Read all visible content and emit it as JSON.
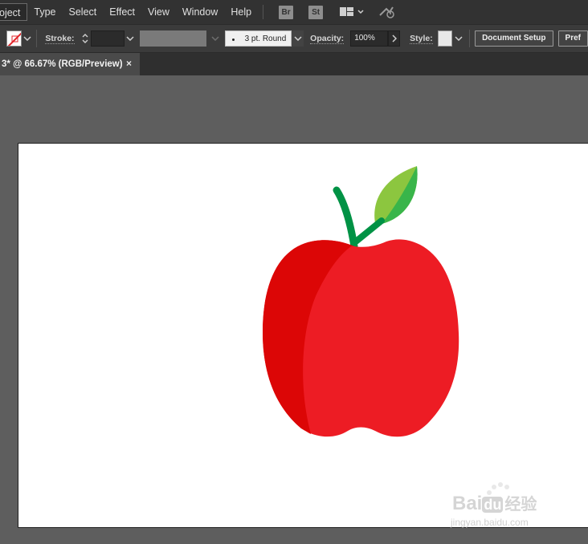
{
  "menubar": {
    "items": [
      {
        "label": "oject",
        "active": true
      },
      {
        "label": "Type"
      },
      {
        "label": "Select"
      },
      {
        "label": "Effect"
      },
      {
        "label": "View"
      },
      {
        "label": "Window"
      },
      {
        "label": "Help"
      }
    ],
    "bridge_label": "Br",
    "stock_label": "St",
    "icons": [
      "arrange-documents-icon",
      "gpu-performance-icon"
    ]
  },
  "controlbar": {
    "stroke_label": "Stroke:",
    "stroke_weight_value": "",
    "brush_value": "3 pt. Round",
    "opacity_label": "Opacity:",
    "opacity_value": "100%",
    "style_label": "Style:",
    "document_setup_label": "Document Setup",
    "preferences_label": "Pref"
  },
  "tab": {
    "title": "3* @ 66.67% (RGB/Preview)",
    "close": "×"
  },
  "artwork": {
    "colors": {
      "apple_red": "#ed1c24",
      "apple_shadow": "#dc0606",
      "stem": "#009245",
      "leaf_light": "#8cc63f",
      "leaf_dark": "#39b54a"
    }
  },
  "watermark": {
    "brand": "Bai",
    "brand2": "du",
    "cn": "经验",
    "url": "jingyan.baidu.com"
  }
}
